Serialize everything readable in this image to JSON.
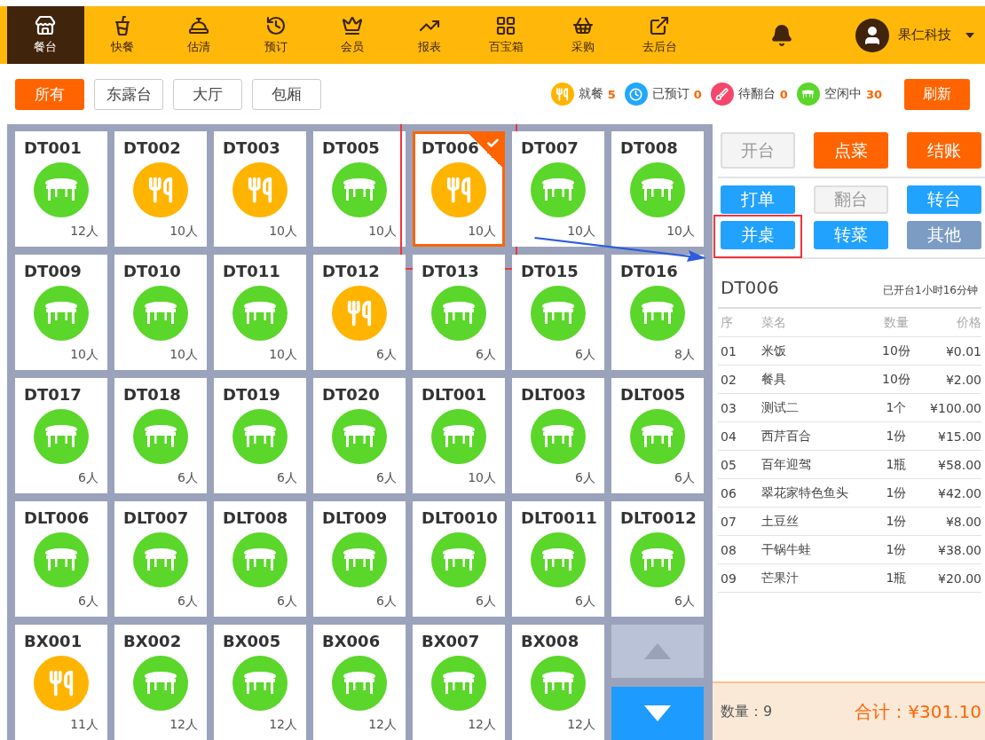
{
  "nav": {
    "items": [
      {
        "label": "餐台",
        "selected": true
      },
      {
        "label": "快餐",
        "selected": false
      },
      {
        "label": "估清",
        "selected": false
      },
      {
        "label": "预订",
        "selected": false
      },
      {
        "label": "会员",
        "selected": false
      },
      {
        "label": "报表",
        "selected": false
      },
      {
        "label": "百宝箱",
        "selected": false
      },
      {
        "label": "采购",
        "selected": false
      },
      {
        "label": "去后台",
        "selected": false
      }
    ],
    "user": "果仁科技"
  },
  "filters": [
    {
      "label": "所有",
      "selected": true
    },
    {
      "label": "东露台",
      "selected": false
    },
    {
      "label": "大厅",
      "selected": false
    },
    {
      "label": "包厢",
      "selected": false
    }
  ],
  "legend": [
    {
      "kind": "dining",
      "label": "就餐",
      "count": "5",
      "color": "#ffb400"
    },
    {
      "kind": "reserved",
      "label": "已预订",
      "count": "0",
      "color": "#22a7ff"
    },
    {
      "kind": "turnover",
      "label": "待翻台",
      "count": "0",
      "color": "#f5476b"
    },
    {
      "kind": "idle",
      "label": "空闲中",
      "count": "30",
      "color": "#5bd62a"
    }
  ],
  "refresh": "刷新",
  "tables": [
    {
      "name": "DT001",
      "kind": "idle",
      "seats": "12人",
      "selected": false,
      "highlighted": false
    },
    {
      "name": "DT002",
      "kind": "dining",
      "seats": "10人",
      "selected": false,
      "highlighted": false
    },
    {
      "name": "DT003",
      "kind": "dining",
      "seats": "10人",
      "selected": false,
      "highlighted": false
    },
    {
      "name": "DT005",
      "kind": "idle",
      "seats": "10人",
      "selected": false,
      "highlighted": false
    },
    {
      "name": "DT006",
      "kind": "dining",
      "seats": "10人",
      "selected": true,
      "highlighted": true
    },
    {
      "name": "DT007",
      "kind": "idle",
      "seats": "10人",
      "selected": false,
      "highlighted": false
    },
    {
      "name": "DT008",
      "kind": "idle",
      "seats": "10人",
      "selected": false,
      "highlighted": false
    },
    {
      "name": "DT009",
      "kind": "idle",
      "seats": "10人",
      "selected": false,
      "highlighted": false
    },
    {
      "name": "DT010",
      "kind": "idle",
      "seats": "10人",
      "selected": false,
      "highlighted": false
    },
    {
      "name": "DT011",
      "kind": "idle",
      "seats": "10人",
      "selected": false,
      "highlighted": false
    },
    {
      "name": "DT012",
      "kind": "dining",
      "seats": "6人",
      "selected": false,
      "highlighted": false
    },
    {
      "name": "DT013",
      "kind": "idle",
      "seats": "6人",
      "selected": false,
      "highlighted": false
    },
    {
      "name": "DT015",
      "kind": "idle",
      "seats": "6人",
      "selected": false,
      "highlighted": false
    },
    {
      "name": "DT016",
      "kind": "idle",
      "seats": "8人",
      "selected": false,
      "highlighted": false
    },
    {
      "name": "DT017",
      "kind": "idle",
      "seats": "6人",
      "selected": false,
      "highlighted": false
    },
    {
      "name": "DT018",
      "kind": "idle",
      "seats": "6人",
      "selected": false,
      "highlighted": false
    },
    {
      "name": "DT019",
      "kind": "idle",
      "seats": "6人",
      "selected": false,
      "highlighted": false
    },
    {
      "name": "DT020",
      "kind": "idle",
      "seats": "6人",
      "selected": false,
      "highlighted": false
    },
    {
      "name": "DLT001",
      "kind": "idle",
      "seats": "10人",
      "selected": false,
      "highlighted": false
    },
    {
      "name": "DLT003",
      "kind": "idle",
      "seats": "6人",
      "selected": false,
      "highlighted": false
    },
    {
      "name": "DLT005",
      "kind": "idle",
      "seats": "6人",
      "selected": false,
      "highlighted": false
    },
    {
      "name": "DLT006",
      "kind": "idle",
      "seats": "6人",
      "selected": false,
      "highlighted": false
    },
    {
      "name": "DLT007",
      "kind": "idle",
      "seats": "6人",
      "selected": false,
      "highlighted": false
    },
    {
      "name": "DLT008",
      "kind": "idle",
      "seats": "6人",
      "selected": false,
      "highlighted": false
    },
    {
      "name": "DLT009",
      "kind": "idle",
      "seats": "6人",
      "selected": false,
      "highlighted": false
    },
    {
      "name": "DLT0010",
      "kind": "idle",
      "seats": "6人",
      "selected": false,
      "highlighted": false
    },
    {
      "name": "DLT0011",
      "kind": "idle",
      "seats": "6人",
      "selected": false,
      "highlighted": false
    },
    {
      "name": "DLT0012",
      "kind": "idle",
      "seats": "6人",
      "selected": false,
      "highlighted": false
    },
    {
      "name": "BX001",
      "kind": "dining",
      "seats": "11人",
      "selected": false,
      "highlighted": false
    },
    {
      "name": "BX002",
      "kind": "idle",
      "seats": "12人",
      "selected": false,
      "highlighted": false
    },
    {
      "name": "BX005",
      "kind": "idle",
      "seats": "12人",
      "selected": false,
      "highlighted": false
    },
    {
      "name": "BX006",
      "kind": "idle",
      "seats": "12人",
      "selected": false,
      "highlighted": false
    },
    {
      "name": "BX007",
      "kind": "idle",
      "seats": "12人",
      "selected": false,
      "highlighted": false
    },
    {
      "name": "BX008",
      "kind": "idle",
      "seats": "12人",
      "selected": false,
      "highlighted": false
    }
  ],
  "actions": [
    [
      {
        "label": "开台",
        "kind": "disabled"
      },
      {
        "label": "点菜",
        "kind": "primary"
      },
      {
        "label": "结账",
        "kind": "primary"
      }
    ],
    [
      {
        "label": "打单",
        "kind": "action"
      },
      {
        "label": "翻台",
        "kind": "disabled"
      },
      {
        "label": "转台",
        "kind": "action"
      }
    ],
    [
      {
        "label": "并桌",
        "kind": "action",
        "highlighted": true
      },
      {
        "label": "转菜",
        "kind": "action"
      },
      {
        "label": "其他",
        "kind": "secondary"
      }
    ]
  ],
  "order": {
    "table": "DT006",
    "duration": "已开台1小时16分钟",
    "columns": [
      "序",
      "菜名",
      "数量",
      "价格"
    ],
    "rows": [
      [
        "01",
        "米饭",
        "10份",
        "¥0.01"
      ],
      [
        "02",
        "餐具",
        "10份",
        "¥2.00"
      ],
      [
        "03",
        "测试二",
        "1个",
        "¥100.00"
      ],
      [
        "04",
        "西芹百合",
        "1份",
        "¥15.00"
      ],
      [
        "05",
        "百年迎驾",
        "1瓶",
        "¥58.00"
      ],
      [
        "06",
        "翠花家特色鱼头",
        "1份",
        "¥42.00"
      ],
      [
        "07",
        "土豆丝",
        "1份",
        "¥8.00"
      ],
      [
        "08",
        "干锅牛蛙",
        "1份",
        "¥38.00"
      ],
      [
        "09",
        "芒果汁",
        "1瓶",
        "¥20.00"
      ]
    ],
    "count": "数量：9",
    "total": "合计：¥301.10"
  }
}
